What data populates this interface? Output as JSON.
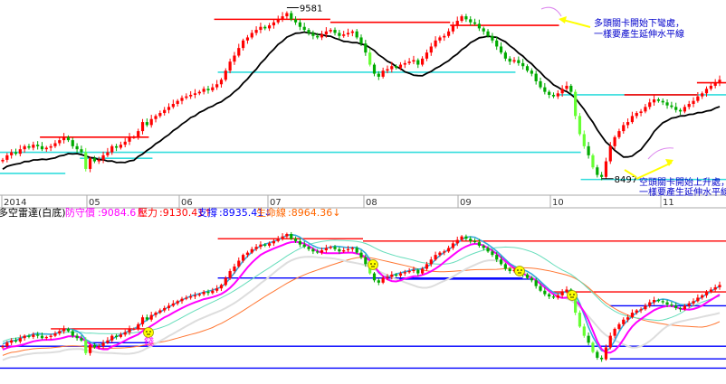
{
  "colors": {
    "background": "#ffffff",
    "candle_up": "#ff0000",
    "candle_down": "#00aa00",
    "candle_long_down": "#66ff33",
    "resistance_line": "#ff0000",
    "support_line": "#0000ff",
    "cyan_line": "#33dddd",
    "top_trend": "#000000",
    "mid_magenta": "#ff00ff",
    "mid_white": "#ffffff",
    "mid_cyan": "#33aadd",
    "mid_orange": "#ff7733",
    "mid_palegreen": "#66ddbb",
    "annotation_text": "#0000cc",
    "annotation_arrow": "#ffff00",
    "date_axis_text": "#333333",
    "separator": "#aaaaaa",
    "label_red": "#ff0000",
    "label_magenta": "#ff00ff",
    "label_blue": "#0000ff",
    "label_orange": "#ff6600",
    "label_black": "#000000"
  },
  "chart_data": [
    {
      "type": "candlestick",
      "title": "",
      "x_axis_labels": [
        "2014",
        "05",
        "06",
        "07",
        "08",
        "09",
        "10",
        "11"
      ],
      "price_labels": [
        "9581",
        "8497"
      ],
      "annotations": [
        {
          "text_line1": "多頭關卡開始下彎處，",
          "text_line2": "一樣要產生延伸水平線"
        },
        {
          "text_line1": "空頭關卡開始上升處，",
          "text_line2": "一樣要產生延伸水平線"
        }
      ],
      "series": [
        {
          "name": "close",
          "values": [
            8610,
            8640,
            8660,
            8650,
            8680,
            8700,
            8690,
            8710,
            8700,
            8680,
            8690,
            8700,
            8720,
            8740,
            8760,
            8740,
            8700,
            8680,
            8660,
            8550,
            8620,
            8600,
            8610,
            8640,
            8660,
            8700,
            8690,
            8710,
            8730,
            8760,
            8760,
            8800,
            8860,
            8840,
            8880,
            8900,
            8920,
            8940,
            8960,
            8980,
            9000,
            9020,
            9030,
            9040,
            9050,
            9060,
            9080,
            9070,
            9090,
            9110,
            9140,
            9200,
            9260,
            9300,
            9350,
            9400,
            9420,
            9450,
            9470,
            9490,
            9480,
            9500,
            9520,
            9540,
            9560,
            9581,
            9540,
            9520,
            9490,
            9470,
            9450,
            9430,
            9420,
            9440,
            9460,
            9470,
            9450,
            9430,
            9440,
            9450,
            9460,
            9420,
            9380,
            9320,
            9240,
            9180,
            9160,
            9200,
            9210,
            9230,
            9220,
            9240,
            9250,
            9260,
            9270,
            9240,
            9280,
            9320,
            9360,
            9400,
            9420,
            9430,
            9460,
            9500,
            9530,
            9560,
            9540,
            9520,
            9510,
            9480,
            9460,
            9430,
            9400,
            9360,
            9320,
            9280,
            9260,
            9270,
            9250,
            9230,
            9200,
            9180,
            9130,
            9090,
            9060,
            9040,
            9030,
            9050,
            9080,
            9100,
            9060,
            8900,
            8780,
            8700,
            8640,
            8560,
            8510,
            8497,
            8600,
            8700,
            8760,
            8800,
            8840,
            8860,
            8900,
            8920,
            8930,
            8960,
            8990,
            9010,
            9000,
            8990,
            8970,
            8960,
            8940,
            8930,
            8960,
            8980,
            9000,
            9030,
            9050,
            9080,
            9100,
            9120,
            9140
          ]
        }
      ],
      "overlays": [
        {
          "name": "resistance",
          "values": [
            {
              "from": 0.055,
              "to": 0.205,
              "y": 8760
            },
            {
              "from": 0.295,
              "to": 0.455,
              "y": 9540
            },
            {
              "from": 0.455,
              "to": 0.62,
              "y": 9520
            },
            {
              "from": 0.62,
              "to": 0.77,
              "y": 9500
            },
            {
              "from": 0.86,
              "to": 0.96,
              "y": 9040
            },
            {
              "from": 0.96,
              "to": 1.0,
              "y": 9120
            }
          ]
        },
        {
          "name": "cyan_support",
          "values": [
            {
              "from": 0.0,
              "to": 0.09,
              "y": 8520
            },
            {
              "from": 0.0,
              "to": 0.8,
              "y": 8660
            },
            {
              "from": 0.11,
              "to": 0.21,
              "y": 8620
            },
            {
              "from": 0.3,
              "to": 0.71,
              "y": 9190
            },
            {
              "from": 0.77,
              "to": 1.0,
              "y": 9040
            },
            {
              "from": 0.8,
              "to": 1.0,
              "y": 8480
            }
          ]
        }
      ]
    },
    {
      "type": "candlestick",
      "title": "多空雷達(白底)",
      "legend": [
        {
          "label": "防守價",
          "value": "9084.6",
          "arrow": "↑"
        },
        {
          "label": "壓力",
          "value": "9130.41",
          "arrow": "↑"
        },
        {
          "label": "支撐",
          "value": "8935.41",
          "arrow": "↓"
        },
        {
          "label": "生命線",
          "value": "8964.36",
          "arrow": "↓"
        }
      ],
      "marker_text": "錢"
    }
  ]
}
